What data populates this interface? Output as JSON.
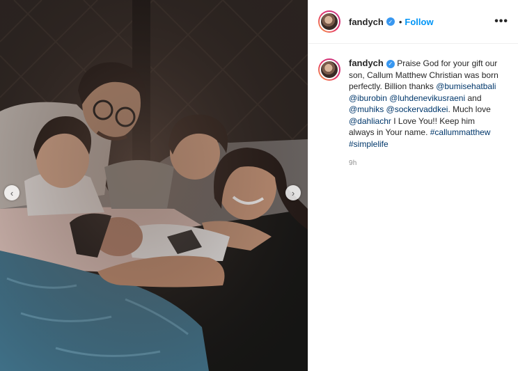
{
  "post": {
    "username": "fandych",
    "verified_glyph": "✓",
    "separator": "•",
    "follow_label": "Follow",
    "more_icon": "•••",
    "nav_prev_glyph": "‹",
    "nav_next_glyph": "›"
  },
  "caption": {
    "username": "fandych",
    "part1": "Praise God for your gift our son, Callum Matthew Christian was born perfectly. Billion thanks",
    "mentions": [
      "@bumisehatbali",
      "@iburobin",
      "@luhdenevikusraeni",
      "@muhiks",
      "@sockervaddkei",
      "@dahliachr"
    ],
    "and_word": "and",
    "part2": ". Much love",
    "part3": "I Love You!! Keep him always in Your name.",
    "hashtags": [
      "#callummatthew",
      "#simplelife"
    ],
    "timestamp": "9h"
  },
  "colors": {
    "link": "#00376b",
    "follow": "#0095f6",
    "verified": "#3897f0",
    "muted": "#8e8e8e"
  }
}
